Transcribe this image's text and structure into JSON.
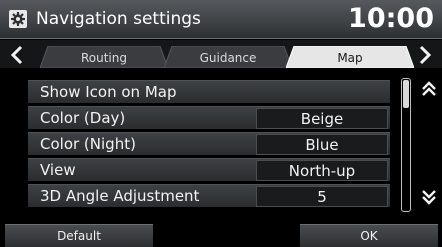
{
  "header": {
    "title": "Navigation settings",
    "clock": "10:00",
    "icon": "gear-icon"
  },
  "tabs": [
    {
      "label": "Routing",
      "active": false
    },
    {
      "label": "Guidance",
      "active": false
    },
    {
      "label": "Map",
      "active": true
    }
  ],
  "settings": [
    {
      "label": "Show Icon on Map",
      "value": ""
    },
    {
      "label": "Color (Day)",
      "value": "Beige"
    },
    {
      "label": "Color (Night)",
      "value": "Blue"
    },
    {
      "label": "View",
      "value": "North-up"
    },
    {
      "label": "3D Angle Adjustment",
      "value": "5"
    }
  ],
  "buttons": {
    "default_label": "Default",
    "ok_label": "OK"
  },
  "colors": {
    "background": "#000000",
    "active_tab": "#e6e6e6",
    "row": "#36393c"
  }
}
